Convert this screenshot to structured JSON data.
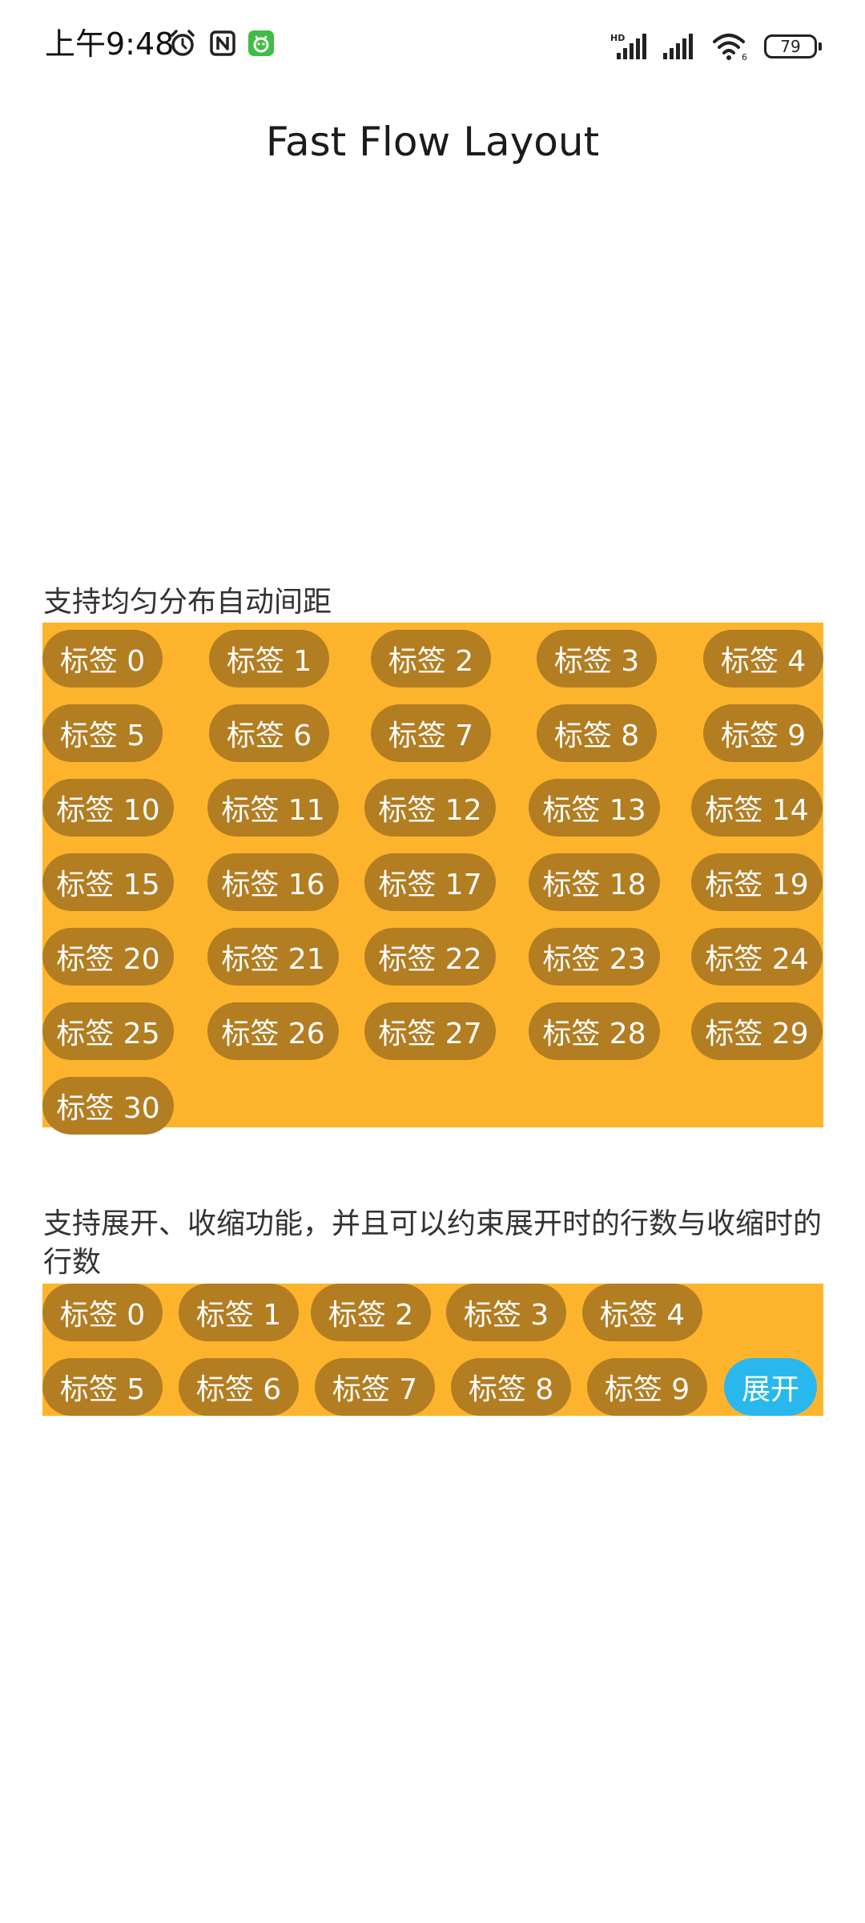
{
  "status_bar": {
    "time": "上午9:48",
    "icons": [
      "alarm-icon",
      "nfc-icon",
      "app-notification-icon",
      "signal-hd-icon",
      "signal-icon",
      "wifi-icon"
    ],
    "battery": "79"
  },
  "title": "Fast Flow Layout",
  "section_even": {
    "label": "支持均匀分布自动间距",
    "tags": [
      "标签 0",
      "标签 1",
      "标签 2",
      "标签 3",
      "标签 4",
      "标签 5",
      "标签 6",
      "标签 7",
      "标签 8",
      "标签 9",
      "标签 10",
      "标签 11",
      "标签 12",
      "标签 13",
      "标签 14",
      "标签 15",
      "标签 16",
      "标签 17",
      "标签 18",
      "标签 19",
      "标签 20",
      "标签 21",
      "标签 22",
      "标签 23",
      "标签 24",
      "标签 25",
      "标签 26",
      "标签 27",
      "标签 28",
      "标签 29",
      "标签 30"
    ]
  },
  "section_expand": {
    "label": "支持展开、收缩功能，并且可以约束展开时的行数与收缩时的行数",
    "tags": [
      "标签 0",
      "标签 1",
      "标签 2",
      "标签 3",
      "标签 4",
      "标签 5",
      "标签 6",
      "标签 7",
      "标签 8",
      "标签 9"
    ],
    "expand_button": "展开"
  },
  "colors": {
    "container": "#fdb42c",
    "tag": "#b37d22",
    "tag_text": "#ffffff",
    "expand_button": "#29b8ee"
  }
}
